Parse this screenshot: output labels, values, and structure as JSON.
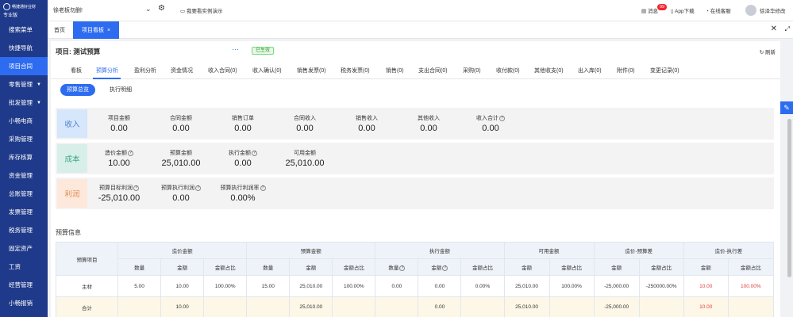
{
  "sidebar": {
    "logo_line1": "畅捷通好业财",
    "logo_line2": "专业版",
    "items": [
      {
        "label": "搜索菜单",
        "active": false,
        "caret": false
      },
      {
        "label": "快捷导航",
        "active": false,
        "caret": false
      },
      {
        "label": "项目合同",
        "active": true,
        "caret": false
      },
      {
        "label": "零售管理",
        "active": false,
        "caret": true
      },
      {
        "label": "批发管理",
        "active": false,
        "caret": true
      },
      {
        "label": "小畅电商",
        "active": false,
        "caret": false
      },
      {
        "label": "采购管理",
        "active": false,
        "caret": false
      },
      {
        "label": "库存核算",
        "active": false,
        "caret": false
      },
      {
        "label": "资金管理",
        "active": false,
        "caret": false
      },
      {
        "label": "总账管理",
        "active": false,
        "caret": false
      },
      {
        "label": "发票管理",
        "active": false,
        "caret": false
      },
      {
        "label": "税务管理",
        "active": false,
        "caret": false
      },
      {
        "label": "固定资产",
        "active": false,
        "caret": false
      },
      {
        "label": "工资",
        "active": false,
        "caret": false
      },
      {
        "label": "经营管理",
        "active": false,
        "caret": false
      },
      {
        "label": "小畅报销",
        "active": false,
        "caret": false
      }
    ]
  },
  "topbar": {
    "account": "徐老板勿删!",
    "demo": "我要看实例演示",
    "badge": "99",
    "message": "消息",
    "app": "App下载",
    "service": "在线客服",
    "user": "徐泽华修改"
  },
  "tabs": {
    "home": "首页",
    "current": "项目看板",
    "close": "×"
  },
  "project": {
    "title": "项目: 测试预算",
    "status": "已生效",
    "refresh": "刷新"
  },
  "main_tabs": [
    "看板",
    "预算分析",
    "盈利分析",
    "资金情况",
    "收入合同(0)",
    "收入确认(0)",
    "销售发票(0)",
    "税务发票(0)",
    "销售(0)",
    "支出合同(0)",
    "采购(0)",
    "收付款(0)",
    "其他收支(0)",
    "出入库(0)",
    "附件(0)",
    "变更记录(0)"
  ],
  "sub_tabs": [
    "预算总览",
    "执行明细"
  ],
  "income": {
    "icon": "收入",
    "metrics": [
      {
        "label": "项目金额",
        "value": "0.00"
      },
      {
        "label": "合同金额",
        "value": "0.00"
      },
      {
        "label": "销售订单",
        "value": "0.00"
      },
      {
        "label": "合同收入",
        "value": "0.00"
      },
      {
        "label": "销售收入",
        "value": "0.00"
      },
      {
        "label": "其他收入",
        "value": "0.00"
      },
      {
        "label": "收入合计",
        "value": "0.00"
      }
    ]
  },
  "cost": {
    "icon": "成本",
    "metrics": [
      {
        "label": "造价金额",
        "value": "10.00"
      },
      {
        "label": "预算金额",
        "value": "25,010.00"
      },
      {
        "label": "执行金额",
        "value": "0.00"
      },
      {
        "label": "可用金额",
        "value": "25,010.00"
      }
    ]
  },
  "profit": {
    "icon": "利润",
    "metrics": [
      {
        "label": "预算目标利润",
        "value": "-25,010.00"
      },
      {
        "label": "预算执行利润",
        "value": "0.00"
      },
      {
        "label": "预算执行利润率",
        "value": "0.00%"
      }
    ]
  },
  "budget": {
    "section_title": "预算信息",
    "row_header": "预算项目",
    "groups": [
      "造价金额",
      "预算金额",
      "执行金额",
      "可用金额",
      "造价-预算差",
      "造价-执行差"
    ],
    "subheaders": [
      [
        "数量",
        "金额",
        "金额占比"
      ],
      [
        "数量",
        "金额",
        "金额占比"
      ],
      [
        "数量",
        "金额",
        "金额占比"
      ],
      [
        "金额",
        "金额占比"
      ],
      [
        "金额",
        "金额占比"
      ],
      [
        "金额",
        "金额占比"
      ]
    ],
    "rows": [
      {
        "name": "主材",
        "cells": [
          "5.00",
          "10.00",
          "100.00%",
          "15.00",
          "25,010.00",
          "100.00%",
          "0.00",
          "0.00",
          "0.00%",
          "25,010.00",
          "100.00%",
          "-25,000.00",
          "-250000.00%",
          "10.00",
          "100.00%"
        ]
      },
      {
        "name": "合计",
        "cells": [
          "",
          "10.00",
          "",
          "",
          "25,010.00",
          "",
          "",
          "0.00",
          "",
          "25,010.00",
          "",
          "-25,000.00",
          "",
          "10.00",
          ""
        ]
      }
    ]
  }
}
